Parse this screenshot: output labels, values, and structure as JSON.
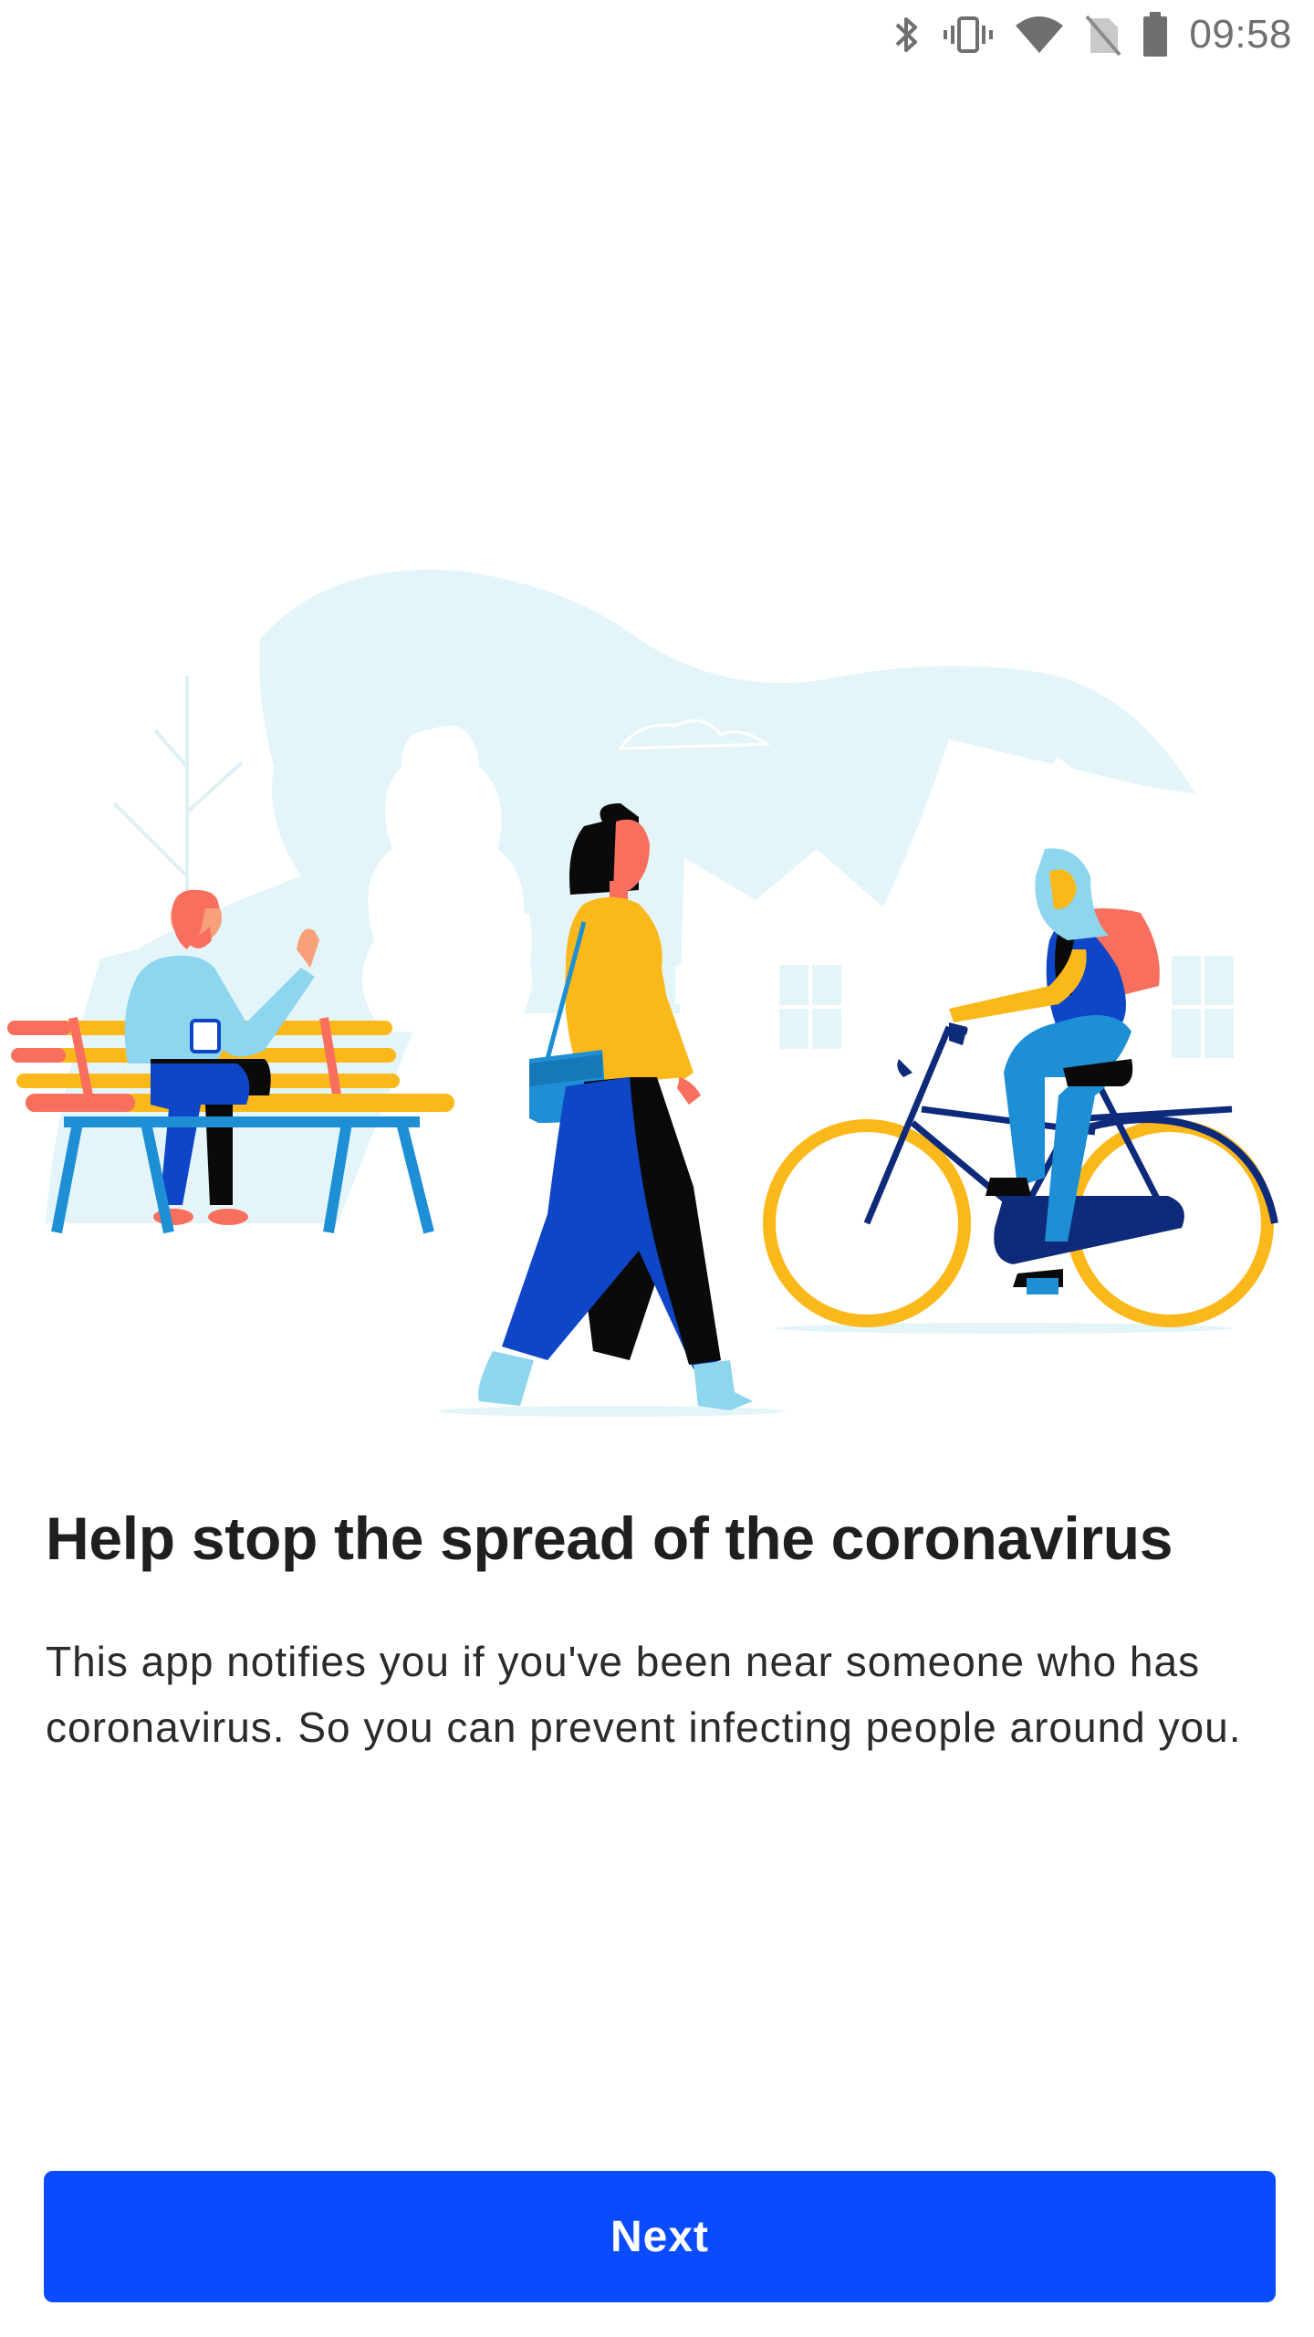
{
  "status_bar": {
    "time": "09:58",
    "icons": [
      "bluetooth-icon",
      "vibrate-icon",
      "wifi-icon",
      "no-sim-icon",
      "battery-icon"
    ],
    "icon_color": "#6f6f6f"
  },
  "illustration": {
    "description_icon": "people-social-distancing-illustration"
  },
  "content": {
    "headline": "Help stop the spread of the coronavirus",
    "body": "This app notifies you if you've been near someone who has coronavirus. So you can prevent infecting people around you."
  },
  "actions": {
    "next_label": "Next"
  },
  "colors": {
    "primary_button": "#0a4bff",
    "background": "#ffffff",
    "illustration_sky": "#e4f5fa",
    "accent_yellow": "#fbb81b",
    "accent_blue": "#0e46c7",
    "accent_orange": "#f86f5e"
  }
}
